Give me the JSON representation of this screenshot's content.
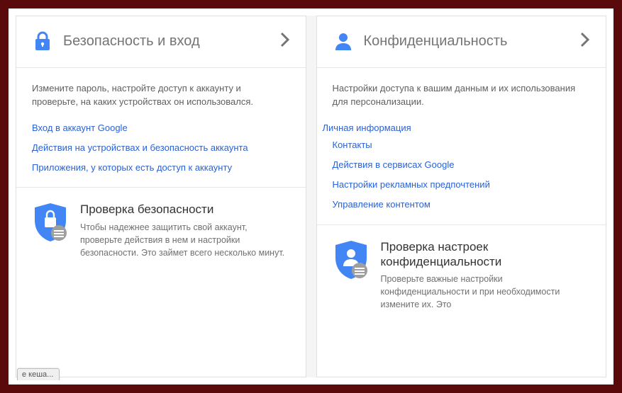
{
  "security": {
    "title": "Безопасность и вход",
    "desc": "Измените пароль, настройте доступ к аккаунту и проверьте, на каких устройствах он использовался.",
    "links": [
      "Вход в аккаунт Google",
      "Действия на устройствах и безопасность аккаунта",
      "Приложения, у которых есть доступ к аккаунту"
    ],
    "check": {
      "title": "Проверка безопасности",
      "desc": "Чтобы надежнее защитить свой аккаунт, проверьте действия в нем и настройки безопасности. Это займет всего несколько минут."
    }
  },
  "privacy": {
    "title": "Конфиденциальность",
    "desc": "Настройки доступа к вашим данным и их использования для персонализации.",
    "links": [
      "Личная информация",
      "Контакты",
      "Действия в сервисах Google",
      "Настройки рекламных предпочтений",
      "Управление контентом"
    ],
    "check": {
      "title": "Проверка настроек конфиденциальности",
      "desc": "Проверьте важные настройки конфиденциальности и при необходимости измените их. Это"
    }
  },
  "status_tab": "е кеша...",
  "colors": {
    "accent": "#4285f4",
    "link": "#2962d6",
    "highlight": "#cc1f1f"
  }
}
